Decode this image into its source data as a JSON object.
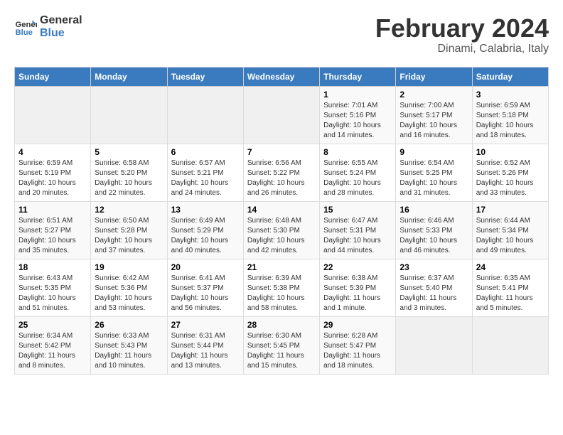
{
  "header": {
    "logo_line1": "General",
    "logo_line2": "Blue",
    "title": "February 2024",
    "subtitle": "Dinami, Calabria, Italy"
  },
  "calendar": {
    "weekdays": [
      "Sunday",
      "Monday",
      "Tuesday",
      "Wednesday",
      "Thursday",
      "Friday",
      "Saturday"
    ],
    "weeks": [
      [
        {
          "day": "",
          "info": ""
        },
        {
          "day": "",
          "info": ""
        },
        {
          "day": "",
          "info": ""
        },
        {
          "day": "",
          "info": ""
        },
        {
          "day": "1",
          "info": "Sunrise: 7:01 AM\nSunset: 5:16 PM\nDaylight: 10 hours\nand 14 minutes."
        },
        {
          "day": "2",
          "info": "Sunrise: 7:00 AM\nSunset: 5:17 PM\nDaylight: 10 hours\nand 16 minutes."
        },
        {
          "day": "3",
          "info": "Sunrise: 6:59 AM\nSunset: 5:18 PM\nDaylight: 10 hours\nand 18 minutes."
        }
      ],
      [
        {
          "day": "4",
          "info": "Sunrise: 6:59 AM\nSunset: 5:19 PM\nDaylight: 10 hours\nand 20 minutes."
        },
        {
          "day": "5",
          "info": "Sunrise: 6:58 AM\nSunset: 5:20 PM\nDaylight: 10 hours\nand 22 minutes."
        },
        {
          "day": "6",
          "info": "Sunrise: 6:57 AM\nSunset: 5:21 PM\nDaylight: 10 hours\nand 24 minutes."
        },
        {
          "day": "7",
          "info": "Sunrise: 6:56 AM\nSunset: 5:22 PM\nDaylight: 10 hours\nand 26 minutes."
        },
        {
          "day": "8",
          "info": "Sunrise: 6:55 AM\nSunset: 5:24 PM\nDaylight: 10 hours\nand 28 minutes."
        },
        {
          "day": "9",
          "info": "Sunrise: 6:54 AM\nSunset: 5:25 PM\nDaylight: 10 hours\nand 31 minutes."
        },
        {
          "day": "10",
          "info": "Sunrise: 6:52 AM\nSunset: 5:26 PM\nDaylight: 10 hours\nand 33 minutes."
        }
      ],
      [
        {
          "day": "11",
          "info": "Sunrise: 6:51 AM\nSunset: 5:27 PM\nDaylight: 10 hours\nand 35 minutes."
        },
        {
          "day": "12",
          "info": "Sunrise: 6:50 AM\nSunset: 5:28 PM\nDaylight: 10 hours\nand 37 minutes."
        },
        {
          "day": "13",
          "info": "Sunrise: 6:49 AM\nSunset: 5:29 PM\nDaylight: 10 hours\nand 40 minutes."
        },
        {
          "day": "14",
          "info": "Sunrise: 6:48 AM\nSunset: 5:30 PM\nDaylight: 10 hours\nand 42 minutes."
        },
        {
          "day": "15",
          "info": "Sunrise: 6:47 AM\nSunset: 5:31 PM\nDaylight: 10 hours\nand 44 minutes."
        },
        {
          "day": "16",
          "info": "Sunrise: 6:46 AM\nSunset: 5:33 PM\nDaylight: 10 hours\nand 46 minutes."
        },
        {
          "day": "17",
          "info": "Sunrise: 6:44 AM\nSunset: 5:34 PM\nDaylight: 10 hours\nand 49 minutes."
        }
      ],
      [
        {
          "day": "18",
          "info": "Sunrise: 6:43 AM\nSunset: 5:35 PM\nDaylight: 10 hours\nand 51 minutes."
        },
        {
          "day": "19",
          "info": "Sunrise: 6:42 AM\nSunset: 5:36 PM\nDaylight: 10 hours\nand 53 minutes."
        },
        {
          "day": "20",
          "info": "Sunrise: 6:41 AM\nSunset: 5:37 PM\nDaylight: 10 hours\nand 56 minutes."
        },
        {
          "day": "21",
          "info": "Sunrise: 6:39 AM\nSunset: 5:38 PM\nDaylight: 10 hours\nand 58 minutes."
        },
        {
          "day": "22",
          "info": "Sunrise: 6:38 AM\nSunset: 5:39 PM\nDaylight: 11 hours\nand 1 minute."
        },
        {
          "day": "23",
          "info": "Sunrise: 6:37 AM\nSunset: 5:40 PM\nDaylight: 11 hours\nand 3 minutes."
        },
        {
          "day": "24",
          "info": "Sunrise: 6:35 AM\nSunset: 5:41 PM\nDaylight: 11 hours\nand 5 minutes."
        }
      ],
      [
        {
          "day": "25",
          "info": "Sunrise: 6:34 AM\nSunset: 5:42 PM\nDaylight: 11 hours\nand 8 minutes."
        },
        {
          "day": "26",
          "info": "Sunrise: 6:33 AM\nSunset: 5:43 PM\nDaylight: 11 hours\nand 10 minutes."
        },
        {
          "day": "27",
          "info": "Sunrise: 6:31 AM\nSunset: 5:44 PM\nDaylight: 11 hours\nand 13 minutes."
        },
        {
          "day": "28",
          "info": "Sunrise: 6:30 AM\nSunset: 5:45 PM\nDaylight: 11 hours\nand 15 minutes."
        },
        {
          "day": "29",
          "info": "Sunrise: 6:28 AM\nSunset: 5:47 PM\nDaylight: 11 hours\nand 18 minutes."
        },
        {
          "day": "",
          "info": ""
        },
        {
          "day": "",
          "info": ""
        }
      ]
    ]
  }
}
